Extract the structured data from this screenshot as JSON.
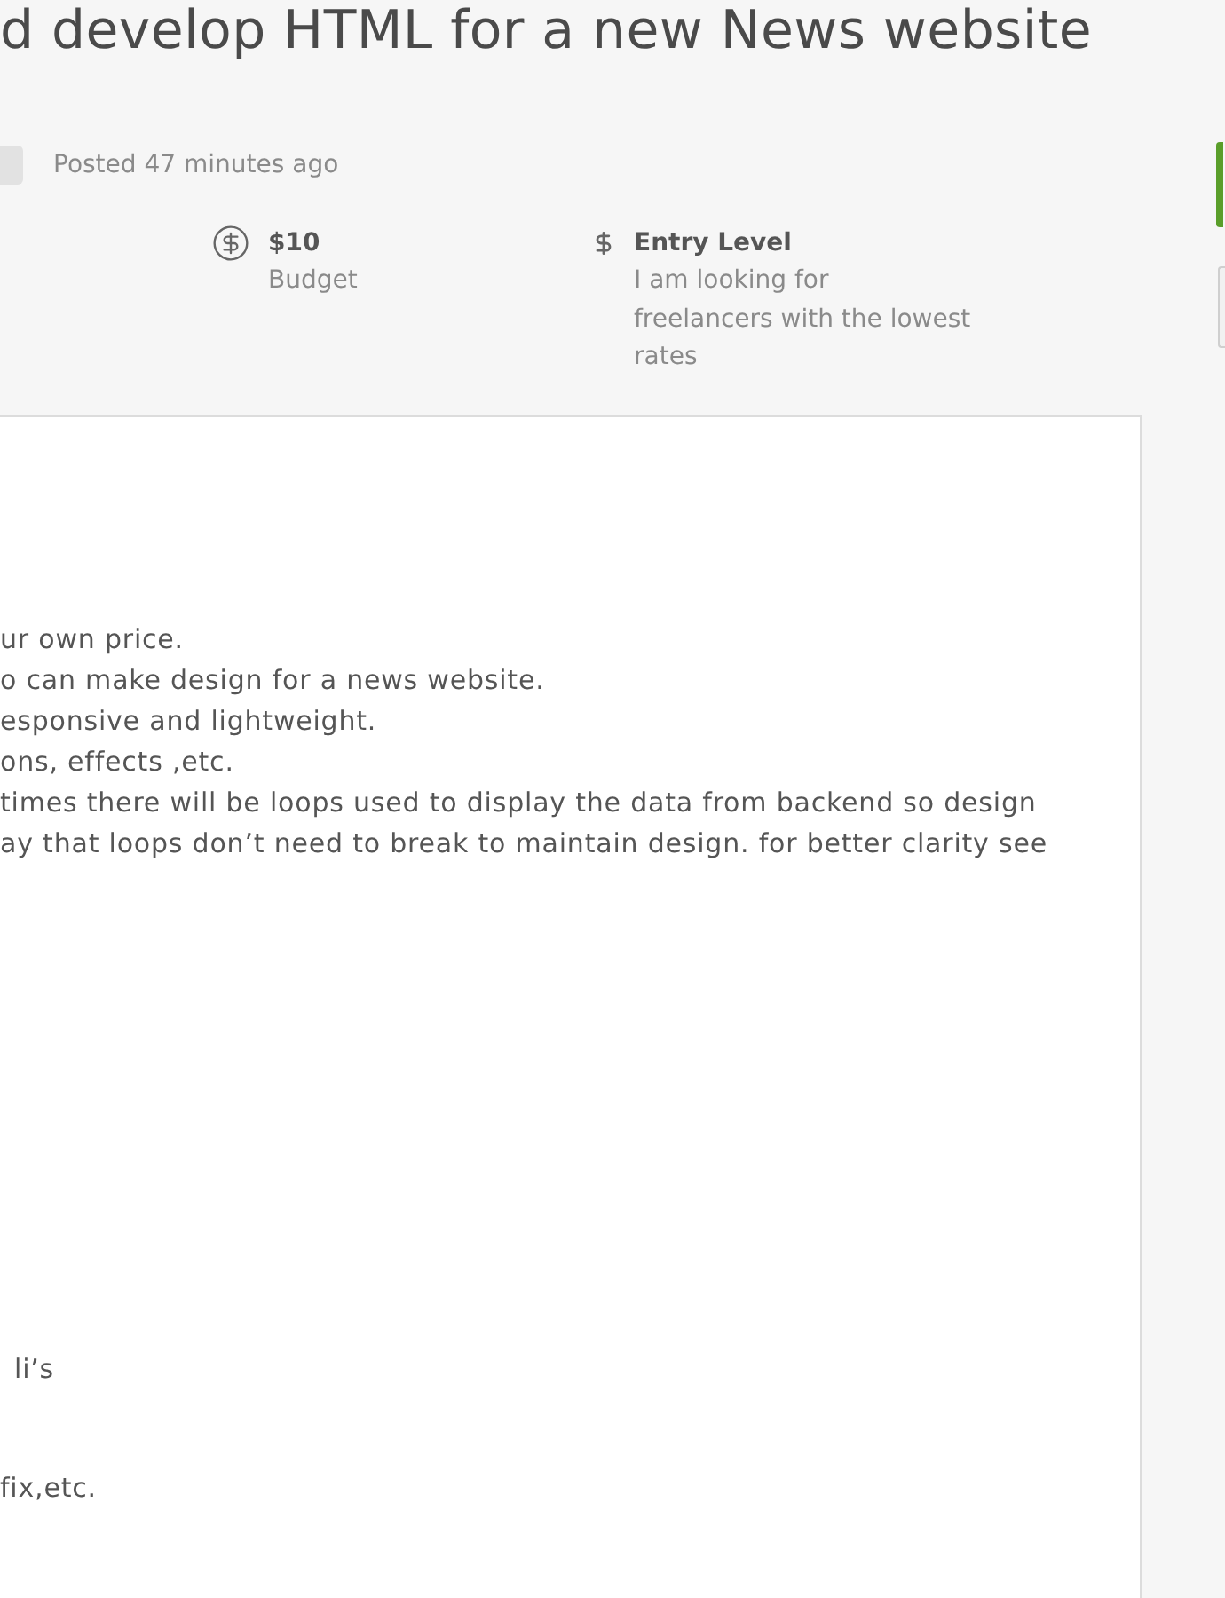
{
  "job": {
    "title": "d develop HTML for a new News website",
    "posted": "Posted 47 minutes ago"
  },
  "stats": [
    {
      "kind": "budget",
      "value": "$10",
      "label": "Budget"
    },
    {
      "kind": "level",
      "value": "Entry Level",
      "label": "I am looking for freelancers with the lowest rates"
    }
  ],
  "description": [
    {
      "lines": [
        "ur own price.",
        "o can make design for a news website.",
        "esponsive and lightweight.",
        "ons, effects ,etc.",
        "times there will be loops used to display the data from backend so design",
        "ay that loops don’t need to break to maintain design. for better clarity see"
      ]
    },
    {
      "lines": [
        "li’s"
      ]
    },
    {
      "lines": [
        "fix,etc."
      ]
    }
  ]
}
